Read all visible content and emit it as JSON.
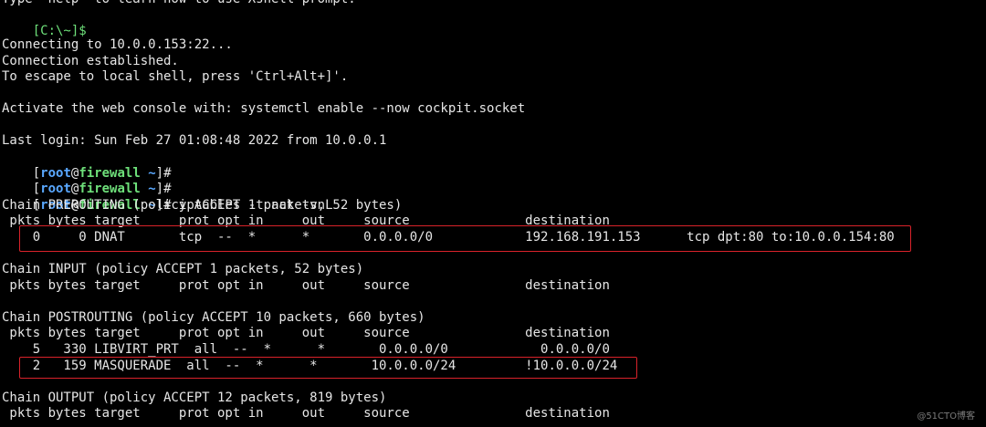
{
  "terminal": {
    "top_cut": "Type `help' to learn how to use Xshell prompt.",
    "local_prompt": "[C:\\~]$",
    "connecting": "Connecting to 10.0.0.153:22...",
    "established": "Connection established.",
    "escape_hint": "To escape to local shell, press 'Ctrl+Alt+]'.",
    "activate": "Activate the web console with: systemctl enable --now cockpit.socket",
    "last_login": "Last login: Sun Feb 27 01:08:48 2022 from 10.0.0.1",
    "prompt": {
      "open": "[",
      "user": "root",
      "at": "@",
      "host": "firewall",
      "path": "~",
      "close": "]",
      "symbol": "#"
    },
    "command": " iptables -t nat -vnL",
    "chains": [
      {
        "header": "Chain PREROUTING (policy ACCEPT 1 packets, 52 bytes)",
        "columns": " pkts bytes target     prot opt in     out     source               destination",
        "rows": [
          "    0     0 DNAT       tcp  --  *      *       0.0.0.0/0            192.168.191.153      tcp dpt:80 to:10.0.0.154:80"
        ]
      },
      {
        "header": "Chain INPUT (policy ACCEPT 1 packets, 52 bytes)",
        "columns": " pkts bytes target     prot opt in     out     source               destination",
        "rows": []
      },
      {
        "header": "Chain POSTROUTING (policy ACCEPT 10 packets, 660 bytes)",
        "columns": " pkts bytes target     prot opt in     out     source               destination",
        "rows": [
          "    5   330 LIBVIRT_PRT  all  --  *      *       0.0.0.0/0            0.0.0.0/0",
          "    2   159 MASQUERADE  all  --  *      *       10.0.0.0/24         !10.0.0.0/24"
        ]
      },
      {
        "header": "Chain OUTPUT (policy ACCEPT 12 packets, 819 bytes)",
        "columns": " pkts bytes target     prot opt in     out     source               destination",
        "rows": []
      }
    ]
  },
  "watermark": "@51CTO博客",
  "colors": {
    "background": "#000000",
    "text": "#e6e6e6",
    "user": "#5aa8ff",
    "host": "#6ee07a",
    "highlight": "#d9222a"
  }
}
